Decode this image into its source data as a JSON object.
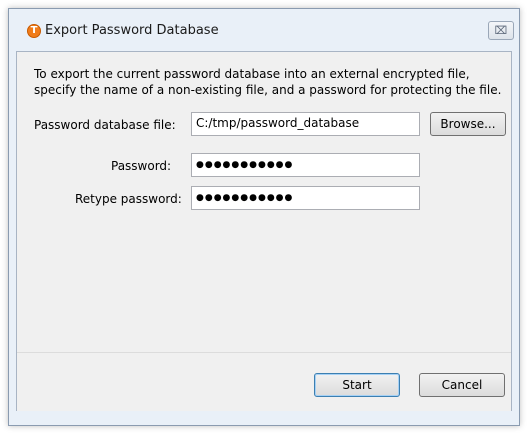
{
  "window": {
    "title": "Export Password Database",
    "app_icon_letter": "T",
    "close_glyph": "⌧"
  },
  "form": {
    "description_line1": "To export the current password database into an external encrypted file,",
    "description_line2": "specify the name of a non-existing file, and a password for protecting the file.",
    "file_label": "Password database file:",
    "file_value": "C:/tmp/password_database",
    "browse_label": "Browse...",
    "password_label": "Password:",
    "password_mask": "●●●●●●●●●●●",
    "retype_label": "Retype password:",
    "retype_mask": "●●●●●●●●●●●"
  },
  "footer": {
    "start_label": "Start",
    "cancel_label": "Cancel"
  }
}
